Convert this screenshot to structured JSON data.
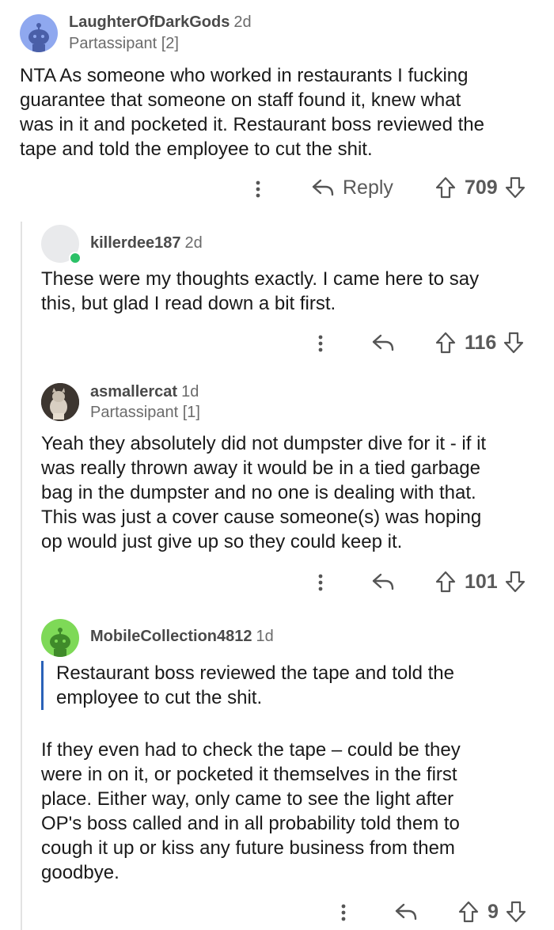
{
  "comments": [
    {
      "username": "LaughterOfDarkGods",
      "age": "2d",
      "flair": "Partassipant [2]",
      "body": [
        "NTA As someone who worked in restaurants I fucking",
        "guarantee that someone on staff found it, knew what",
        "was in it and pocketed it. Restaurant boss reviewed the",
        "tape and told the employee to cut the shit."
      ],
      "reply_label": "Reply",
      "votes": "709",
      "avatar_color": "#8fa8ef"
    },
    {
      "username": "killerdee187",
      "age": "2d",
      "body": [
        "These were my thoughts exactly. I came here to say",
        "this, but glad I read down a bit first."
      ],
      "votes": "116",
      "avatar_color": "#e9eaec",
      "online_color": "#2bc167"
    },
    {
      "username": "asmallercat",
      "age": "1d",
      "flair": "Partassipant [1]",
      "body": [
        "Yeah they absolutely did not dumpster dive for it - if it",
        "was really thrown away it would be in a tied garbage",
        "bag in the dumpster and no one is dealing with that.",
        "This was just a cover cause someone(s) was hoping",
        "op would just give up so they could keep it."
      ],
      "votes": "101"
    },
    {
      "username": "MobileCollection4812",
      "age": "1d",
      "quote": [
        "Restaurant boss reviewed the tape and told the",
        "employee to cut the shit."
      ],
      "body": [
        "If they even had to check the tape – could be they",
        "were in on it, or pocketed it themselves in the first",
        "place. Either way, only came to see the light after",
        "OP's boss called and in all probability told them to",
        "cough it up or kiss any future business from them",
        "goodbye."
      ],
      "votes": "9",
      "avatar_color": "#7ed957"
    }
  ],
  "icons": {
    "more": "more-options-icon",
    "reply": "reply-arrow-icon",
    "upvote": "upvote-arrow-icon",
    "downvote": "downvote-arrow-icon",
    "snoo": "snoo-avatar-icon"
  },
  "colors": {
    "quote_bar": "#2a62b8",
    "thread_line": "#e2e2e2"
  }
}
